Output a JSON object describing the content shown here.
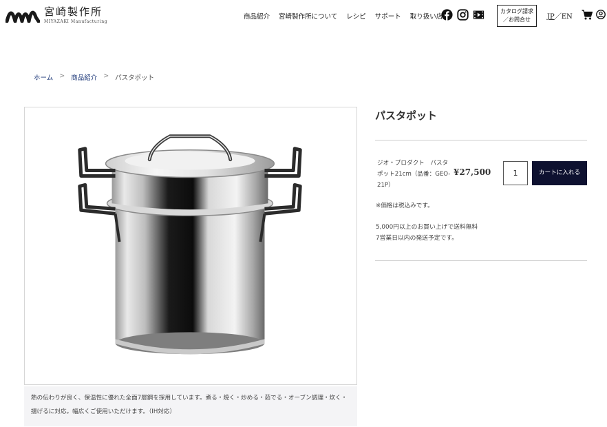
{
  "header": {
    "logo_jp": "宮崎製作所",
    "logo_en": "MIYAZAKI Manufacturing",
    "nav": [
      "商品紹介",
      "宮崎製作所について",
      "レシピ",
      "サポート",
      "取り扱い店舗"
    ],
    "social_icons": [
      "facebook-icon",
      "instagram-icon",
      "youtube-icon"
    ],
    "catalog_line1": "カタログ請求",
    "catalog_line2": "／お問合せ",
    "lang_jp": "JP",
    "lang_sep": "／",
    "lang_en": "EN"
  },
  "breadcrumb": {
    "home": "ホーム",
    "sep": ">",
    "category": "商品紹介",
    "current": "パスタポット"
  },
  "product": {
    "title": "パスタポット",
    "variant_name": "ジオ・プロダクト　パスタポット21cm（品番：GEO-21P）",
    "price": "¥27,500",
    "quantity": "1",
    "add_to_cart": "カートに入れる",
    "tax_note": "※価格は税込みです。",
    "shipping_line1": "5,000円以上のお買い上げで送料無料",
    "shipping_line2": "7営業日以内の発送予定です。",
    "description": "熱の伝わりが良く、保温性に優れた全面7層鋼を採用しています。煮る・焼く・炒める・茹でる・オーブン調理・炊く・揚げるに対応。幅広くご使用いただけます。（IH対応）"
  },
  "colors": {
    "accent": "#0e1130",
    "link": "#1f3a7a",
    "description_bg": "#f4f4f6"
  }
}
